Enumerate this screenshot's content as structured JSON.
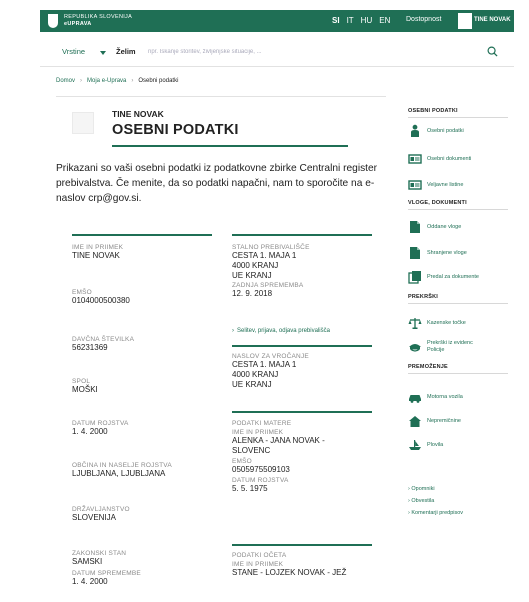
{
  "header": {
    "brand_line1": "REPUBLIKA SLOVENIJA",
    "brand_line2": "eUPRAVA",
    "languages": [
      {
        "label": "SI",
        "active": true
      },
      {
        "label": "IT",
        "active": false
      },
      {
        "label": "HU",
        "active": false
      },
      {
        "label": "EN",
        "active": false
      }
    ],
    "accessibility": "Dostopnost",
    "user_name": "TINE NOVAK",
    "color": "#1f6f55"
  },
  "search": {
    "type_label": "Vrstine",
    "want_label": "Želim",
    "placeholder": "npr. Iskanje storitev, življenjske situacije, ..."
  },
  "breadcrumb": {
    "items": [
      "Domov",
      "Moja e-Uprava",
      "Osebni podatki"
    ]
  },
  "page": {
    "owner_name": "TINE NOVAK",
    "title": "OSEBNI PODATKI",
    "intro": "Prikazani so vaši osebni podatki iz podatkovne zbirke Centralni register prebivalstva. Če menite, da so podatki napačni, nam to sporočite na e-naslov crp@gov.si."
  },
  "left_fields": [
    {
      "label": "IME IN PRIIMEK",
      "value": "TINE NOVAK"
    },
    {
      "label": "EMŠO",
      "value": "0104000500380"
    },
    {
      "label": "DAVČNA ŠTEVILKA",
      "value": "56231369"
    },
    {
      "label": "SPOL",
      "value": "MOŠKI"
    },
    {
      "label": "DATUM ROJSTVA",
      "value": "1. 4. 2000"
    },
    {
      "label": "OBČINA IN NASELJE ROJSTVA",
      "value": "LJUBLJANA, LJUBLJANA"
    },
    {
      "label": "DRŽAVLJANSTVO",
      "value": "SLOVENIJA"
    },
    {
      "label": "ZAKONSKI STAN",
      "value": "SAMSKI"
    },
    {
      "label": "DATUM SPREMEMBE",
      "value": "1. 4. 2000"
    }
  ],
  "right_fields": {
    "permanent_label": "STALNO PREBIVALIŠČE",
    "permanent_address": [
      "CESTA 1. MAJA 1",
      "4000 KRANJ",
      "UE KRANJ"
    ],
    "last_change_label": "ZADNJA SPREMEMBA",
    "last_change_value": "12. 9. 2018",
    "moving_link": "Selitev, prijava, odjava prebivališča",
    "delivery_label": "NASLOV ZA VROČANJE",
    "delivery_address": [
      "CESTA 1. MAJA 1",
      "4000 KRANJ",
      "UE KRANJ"
    ],
    "mother_label": "PODATKI MATERE",
    "mother_name_label": "IME IN PRIIMEK",
    "mother_name": "ALENKA - JANA NOVAK - SLOVENC",
    "mother_emso_label": "EMŠO",
    "mother_emso": "0505975509103",
    "mother_dob_label": "DATUM ROJSTVA",
    "mother_dob": "5. 5. 1975",
    "father_label": "PODATKI OČETA",
    "father_name_label": "IME IN PRIIMEK",
    "father_name": "STANE - LOJZEK NOVAK - JEŽ"
  },
  "sidebar": {
    "sections": [
      {
        "title": "OSEBNI PODATKI",
        "items": [
          {
            "label": "Osebni podatki",
            "icon": "person-icon"
          },
          {
            "label": "Osebni dokumenti",
            "icon": "id-card-icon"
          },
          {
            "label": "Veljavne listine",
            "icon": "id-card-icon"
          }
        ]
      },
      {
        "title": "VLOGE, DOKUMENTI",
        "items": [
          {
            "label": "Oddane vloge",
            "icon": "document-send-icon"
          },
          {
            "label": "Shranjene vloge",
            "icon": "document-saved-icon"
          },
          {
            "label": "Predal za dokumente",
            "icon": "document-drawer-icon"
          }
        ]
      },
      {
        "title": "PREKRŠKI",
        "items": [
          {
            "label": "Kazenske točke",
            "icon": "scales-icon"
          },
          {
            "label": "Prekrški iz evidenc Policije",
            "icon": "police-cap-icon"
          }
        ]
      },
      {
        "title": "PREMOŽENJE",
        "items": [
          {
            "label": "Motorna vozila",
            "icon": "car-icon"
          },
          {
            "label": "Nepremičnine",
            "icon": "house-icon"
          },
          {
            "label": "Plovila",
            "icon": "boat-icon"
          }
        ]
      }
    ],
    "links": [
      "Opomniki",
      "Obvestila",
      "Komentarji predpisov"
    ]
  }
}
